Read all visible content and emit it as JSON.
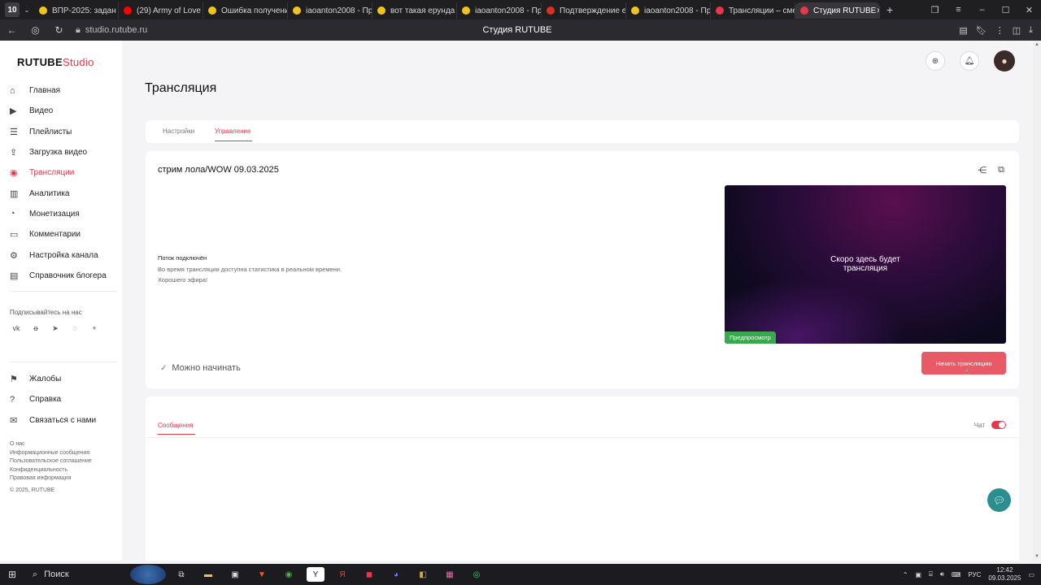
{
  "browser": {
    "profile_badge": "10",
    "tabs": [
      {
        "label": "ВПР-2025: задан",
        "color": "#f0c419"
      },
      {
        "label": "(29) Army of Love",
        "color": "#ff0000"
      },
      {
        "label": "Ошибка получени",
        "color": "#f0c419"
      },
      {
        "label": "iaoanton2008 - Пр",
        "color": "#f0c419"
      },
      {
        "label": "вот такая ерунда",
        "color": "#f0c419"
      },
      {
        "label": "iaoanton2008 - Пр",
        "color": "#f0c419"
      },
      {
        "label": "Подтверждение е",
        "color": "#d93025"
      },
      {
        "label": "iaoanton2008 - Пр",
        "color": "#f0c419"
      },
      {
        "label": "Трансляции – сме",
        "color": "#e8374a"
      },
      {
        "label": "Студия RUTUBE",
        "color": "#e8374a",
        "active": true
      }
    ],
    "url": "studio.rutube.ru",
    "page_title": "Студия RUTUBE"
  },
  "sidebar": {
    "logo_main": "RUTUBE",
    "logo_suffix": "Studio",
    "items": [
      {
        "label": "Главная",
        "icon": "home-icon"
      },
      {
        "label": "Видео",
        "icon": "video-icon"
      },
      {
        "label": "Плейлисты",
        "icon": "playlist-icon"
      },
      {
        "label": "Загрузка видео",
        "icon": "upload-icon"
      },
      {
        "label": "Трансляции",
        "icon": "broadcast-icon",
        "active": true
      },
      {
        "label": "Аналитика",
        "icon": "analytics-icon"
      },
      {
        "label": "Монетизация",
        "icon": "money-icon"
      },
      {
        "label": "Комментарии",
        "icon": "comment-icon"
      },
      {
        "label": "Настройка канала",
        "icon": "settings-icon"
      },
      {
        "label": "Справочник блогера",
        "icon": "book-icon"
      }
    ],
    "subscribe_label": "Подписывайтесь на нас",
    "secondary": [
      {
        "label": "Жалобы",
        "icon": "flag-icon"
      },
      {
        "label": "Справка",
        "icon": "help-icon"
      },
      {
        "label": "Связаться с нами",
        "icon": "mail-icon"
      }
    ],
    "footer_links": [
      "О нас",
      "Информационные сообщения",
      "Пользовательское соглашение",
      "Конфиденциальность",
      "Правовая информация"
    ],
    "copyright": "© 2025, RUTUBE"
  },
  "page": {
    "title": "Трансляция",
    "tabs": [
      {
        "label": "Настройки"
      },
      {
        "label": "Управление",
        "active": true
      }
    ],
    "stream_title": "стрим лола/WOW 09.03.2025",
    "status": {
      "title": "Поток подключён",
      "line1": "Во время трансляции доступна статистика в реальном времени.",
      "line2": "Хорошего эфира!"
    },
    "preview": {
      "line1": "Скоро здесь будет",
      "line2": "трансляция",
      "badge": "Предпросмотр"
    },
    "ready_label": "Можно начинать",
    "start_button": "Начать трансляцию",
    "chat": {
      "messages_tab": "Сообщения",
      "chat_label": "Чат",
      "chat_enabled": true
    }
  },
  "taskbar": {
    "search_label": "Поиск",
    "lang": "РУС",
    "time": "12:42",
    "date": "09.03.2025"
  },
  "colors": {
    "accent": "#e8374a",
    "start_button": "#e85a66",
    "preview_badge": "#3aa84e"
  }
}
